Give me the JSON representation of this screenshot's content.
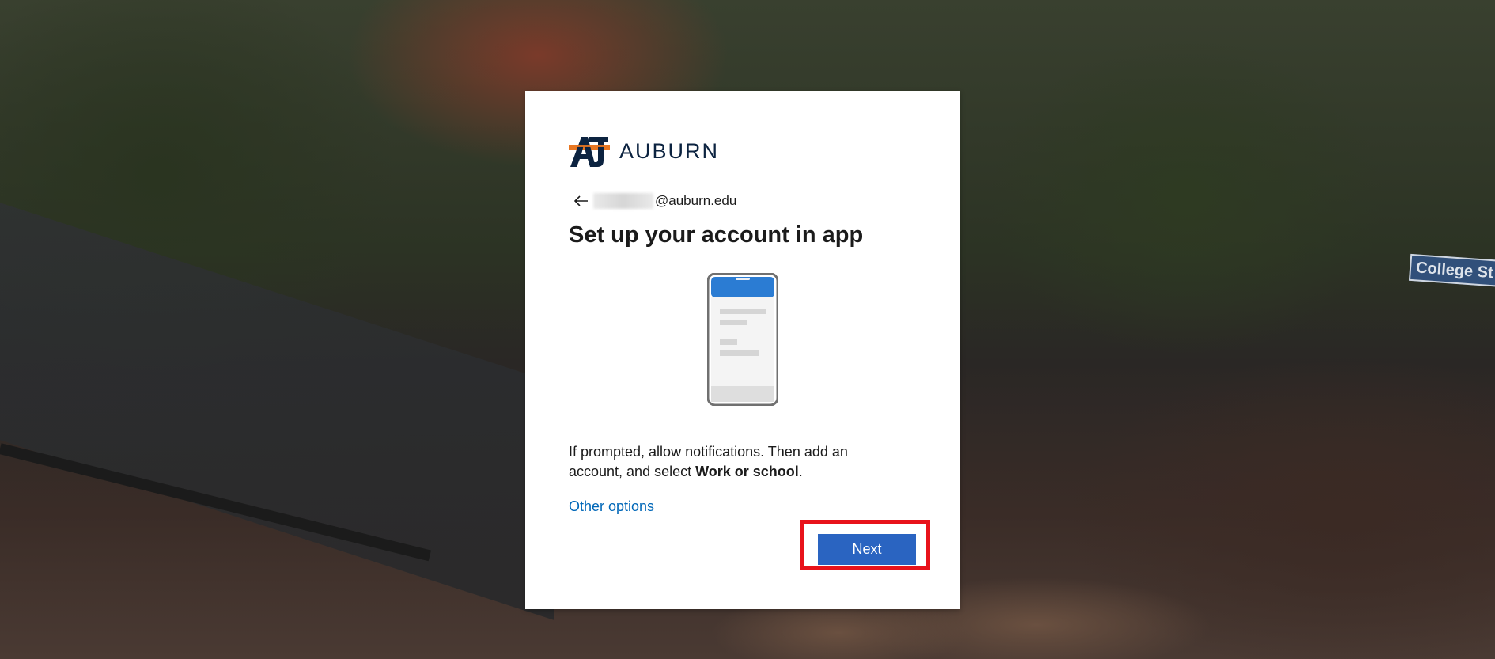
{
  "background": {
    "street_sign_text": "College St"
  },
  "logo": {
    "icon": "auburn-au-logo",
    "text": "AUBURN"
  },
  "identity": {
    "back_icon": "back-arrow-icon",
    "email_suffix": "@auburn.edu"
  },
  "title": "Set up your account in app",
  "illustration": {
    "icon": "smartphone-icon"
  },
  "description": {
    "prefix": "If prompted, allow notifications. Then add an account, and select ",
    "bold": "Work or school",
    "suffix": "."
  },
  "other_options_label": "Other options",
  "next_label": "Next",
  "colors": {
    "accent": "#2a64c1",
    "link": "#0067b8",
    "highlight_border": "#e8121a",
    "brand_navy": "#0c2340",
    "brand_orange": "#e87722"
  }
}
